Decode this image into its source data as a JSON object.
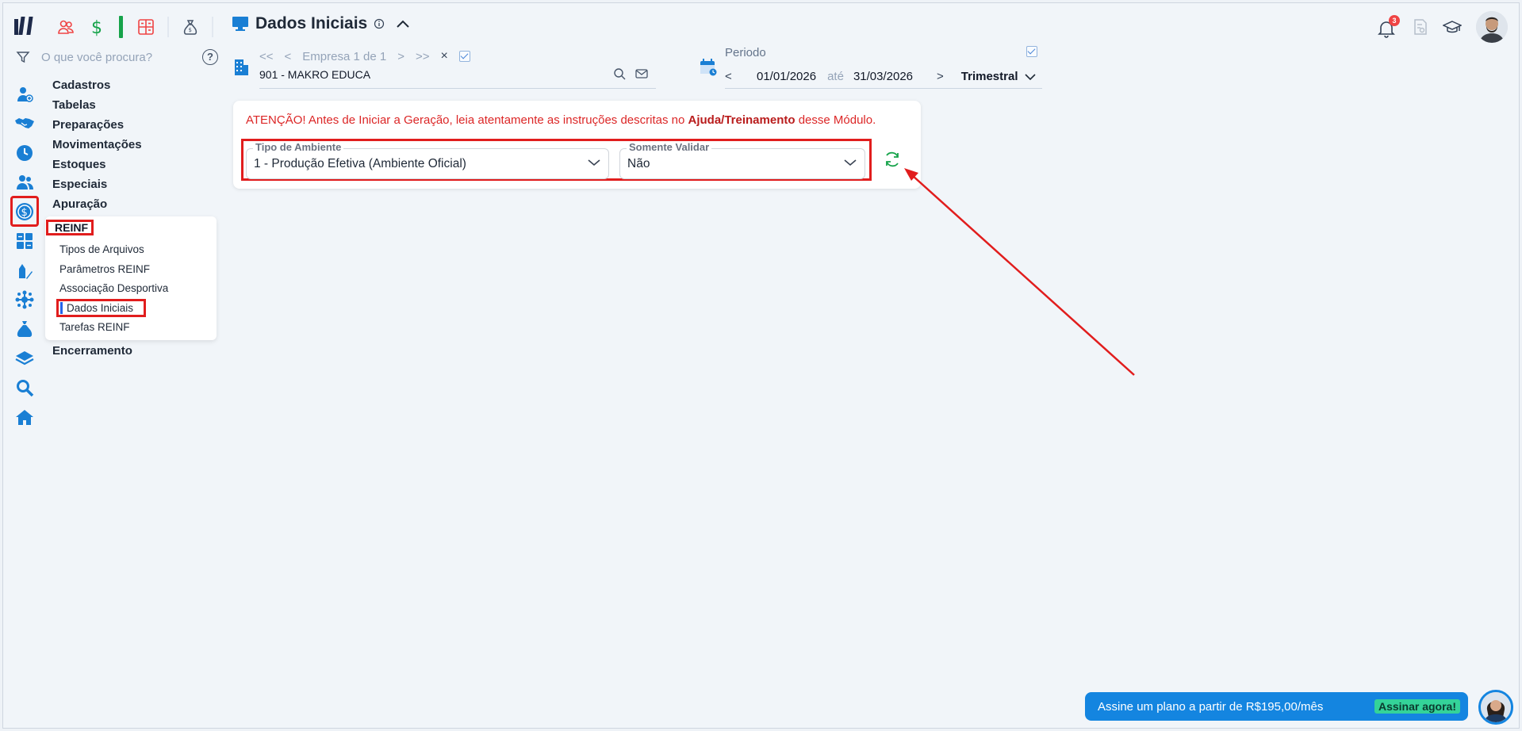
{
  "header": {
    "page_title": "Dados Iniciais",
    "notification_count": "3"
  },
  "search": {
    "placeholder": "O que você procura?",
    "help_label": "?"
  },
  "menu": {
    "items": [
      "Cadastros",
      "Tabelas",
      "Preparações",
      "Movimentações",
      "Estoques",
      "Especiais",
      "Apuração"
    ],
    "submenu_title": "REINF",
    "submenu_items": [
      "Tipos de Arquivos",
      "Parâmetros REINF",
      "Associação Desportiva",
      "Dados Iniciais",
      "Tarefas REINF"
    ],
    "bottom_item": "Encerramento"
  },
  "empresa": {
    "first": "<<",
    "prev": "<",
    "counter": "Empresa 1 de 1",
    "next": ">",
    "last": ">>",
    "clear": "×",
    "selected": "901 - MAKRO EDUCA"
  },
  "periodo": {
    "label": "Periodo",
    "prev": "<",
    "start": "01/01/2026",
    "ate": "até",
    "end": "31/03/2026",
    "next": ">",
    "type": "Trimestral"
  },
  "card": {
    "warning_pre": "ATENÇÃO! Antes de Iniciar a Geração, leia atentamente as instruções descritas no ",
    "warning_bold": "Ajuda/Treinamento",
    "warning_post": " desse Módulo.",
    "field1_label": "Tipo de Ambiente",
    "field1_value": "1 - Produção Efetiva (Ambiente Oficial)",
    "field2_label": "Somente Validar",
    "field2_value": "Não"
  },
  "promo": {
    "text": "Assine um plano a partir de R$195,00/mês",
    "button": "Assinar agora!"
  },
  "colors": {
    "accent": "#1485e0",
    "highlight_red": "#e11d1d",
    "warning_text": "#dc2626",
    "green": "#16a34a"
  }
}
